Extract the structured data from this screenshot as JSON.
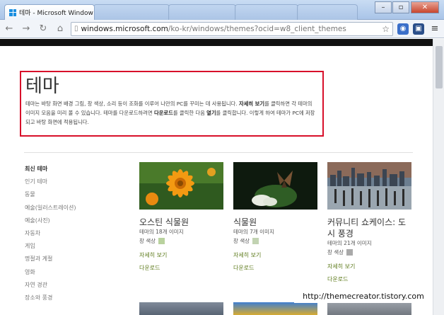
{
  "browser": {
    "active_tab_title": "테마 - Microsoft Window",
    "address_host": "windows.microsoft.com",
    "address_path": "/ko-kr/windows/themes?ocid=w8_client_themes"
  },
  "page": {
    "heading": "테마",
    "intro": {
      "part1": "테마는 바탕 화면 배경 그림, 창 색상, 소리 등이 조화를 이루어 나만의 PC를 꾸미는 데 사용됩니다. ",
      "bold1": "자세히 보기",
      "part2": "를 클릭하면 각 테마의 이미지 모음을 미리 볼 수 있습니다. 테마를 다운로드하려면 ",
      "bold2": "다운로드",
      "part3": "를 클릭한 다음 ",
      "bold3": "열기",
      "part4": "를 클릭합니다. 이렇게 하여 테마가 PC에 저장되고 바탕 화면에 적용됩니다."
    },
    "nav": [
      "최신 테마",
      "인기 테마",
      "동물",
      "예술(일러스트레이션)",
      "예술(사진)",
      "자동차",
      "게임",
      "명절과 계절",
      "영화",
      "자연 경관",
      "장소와 풍경"
    ],
    "themes": [
      {
        "name": "오스틴 식물원",
        "count": "테마의 18개 이미지",
        "color_label": "창 색상",
        "swatch": "#b9d29e",
        "details": "자세히 보기",
        "download": "다운로드"
      },
      {
        "name": "식물원",
        "count": "테마의 7개 이미지",
        "color_label": "창 색상",
        "swatch": "#c2d3b2",
        "details": "자세히 보기",
        "download": "다운로드"
      },
      {
        "name": "커뮤니티 쇼케이스: 도시 풍경",
        "count": "테마의 21개 이미지",
        "color_label": "창 색상",
        "swatch": "#a9a9a9",
        "details": "자세히 보기",
        "download": "다운로드"
      }
    ]
  },
  "watermark": "http://themecreator.tistory.com",
  "colors": {
    "accent_link": "#5c7a1a",
    "highlight_box": "#d8102a"
  }
}
